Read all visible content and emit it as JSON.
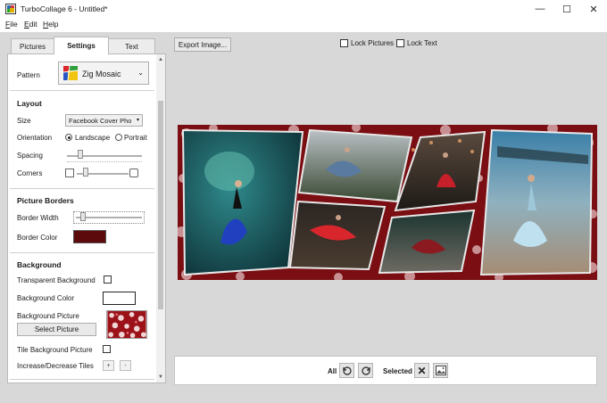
{
  "window": {
    "title": "TurboCollage 6 - Untitled*",
    "minimize_glyph": "—",
    "maximize_glyph": "☐",
    "close_glyph": "✕"
  },
  "menu": [
    "File",
    "Edit",
    "Help"
  ],
  "menu_underline": [
    "F",
    "E",
    "H"
  ],
  "menu_rest": [
    "ile",
    "dit",
    "elp"
  ],
  "tabs": [
    "Pictures",
    "Settings",
    "Text"
  ],
  "active_tab": "Settings",
  "settings": {
    "pattern_label": "Pattern",
    "pattern_value": "Zig Mosaic",
    "layout": {
      "title": "Layout",
      "size_label": "Size",
      "size_value": "Facebook Cover Pho",
      "orientation_label": "Orientation",
      "orientation_options": [
        "Landscape",
        "Portrait"
      ],
      "orientation_selected": "Landscape",
      "spacing_label": "Spacing",
      "spacing_level": 0.08,
      "corners_label": "Corners",
      "corners_level": 0.12
    },
    "borders": {
      "title": "Picture Borders",
      "width_label": "Border Width",
      "width_level": 0.1,
      "color_label": "Border Color",
      "color": "#5c0a0c"
    },
    "background": {
      "title": "Background",
      "transparent_label": "Transparent Background",
      "transparent_checked": false,
      "color_label": "Background Color",
      "color": "#ffffff",
      "picture_label": "Background Picture",
      "select_button": "Select Picture",
      "tile_label": "Tile Background Picture",
      "tile_checked": false,
      "tiles_label": "Increase/Decrease Tiles",
      "plus": "+",
      "minus": "-"
    }
  },
  "toolbar": {
    "export_button": "Export Image...",
    "lock_pictures_label": "Lock Pictures",
    "lock_text_label": "Lock Text",
    "lock_pictures_checked": false,
    "lock_text_checked": false
  },
  "bottom": {
    "all_label": "All",
    "selected_label": "Selected"
  },
  "icons": {
    "rotate_left": "rotate-left-icon",
    "rotate_right": "rotate-right-icon",
    "delete": "delete-icon",
    "image": "image-icon"
  },
  "colors": {
    "collage_background": "#7a0e12",
    "canvas_background": "#d8d8d8"
  }
}
